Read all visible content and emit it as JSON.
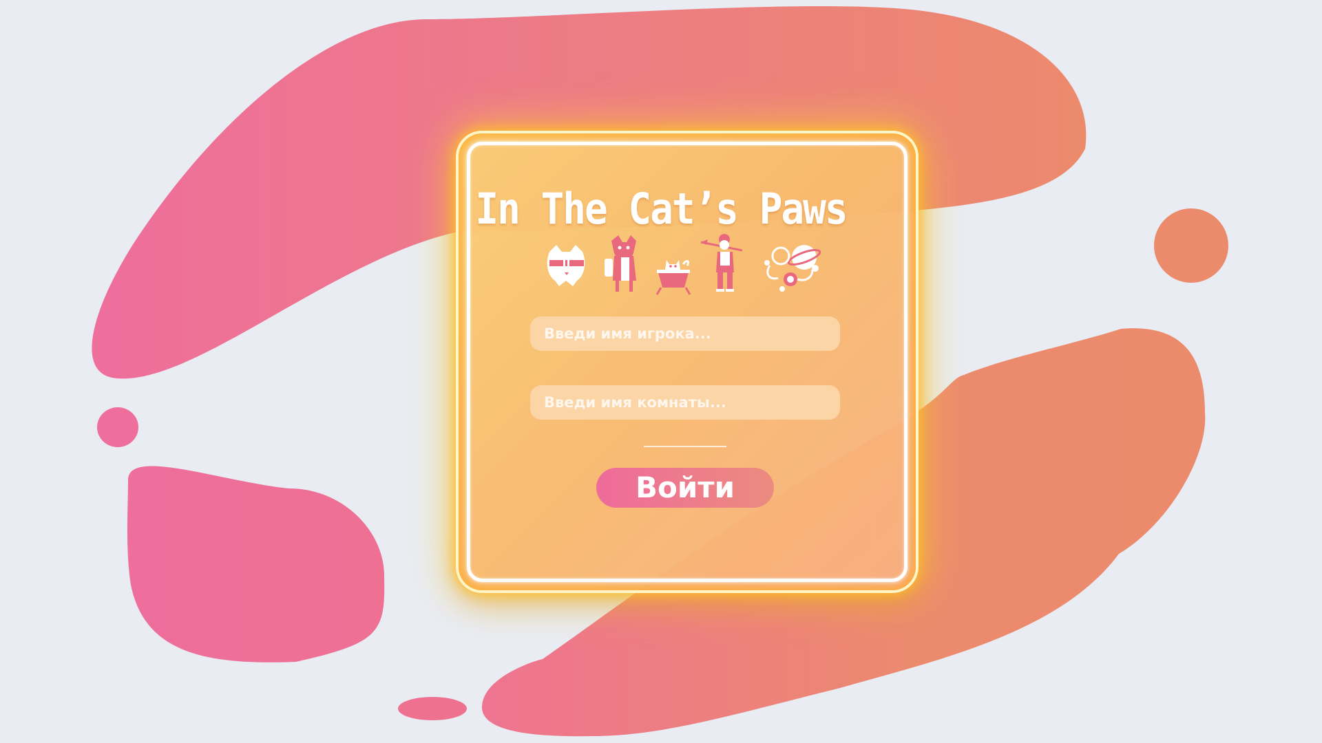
{
  "game": {
    "title": "In The Cat’s Paws"
  },
  "form": {
    "player_placeholder": "Введи имя игрока...",
    "player_value": "",
    "room_placeholder": "Введи имя комнаты...",
    "room_value": "",
    "login_label": "Войти"
  },
  "characters": [
    "cat-with-headband-icon",
    "fox-with-scroll-icon",
    "cat-on-cart-icon",
    "woman-with-spear-icon",
    "cosmic-creature-icon"
  ],
  "colors": {
    "background": "#e9ecf3",
    "blob_pink": "#ee6e9c",
    "blob_coral": "#ec8a6c",
    "panel_orange": "#f8bc6e",
    "glow_yellow": "#ffd53c",
    "input_fill": "#fcd5a7",
    "button_pink": "#ee6b9a",
    "button_coral": "#ec8b7e",
    "character_pink": "#e8697d"
  }
}
